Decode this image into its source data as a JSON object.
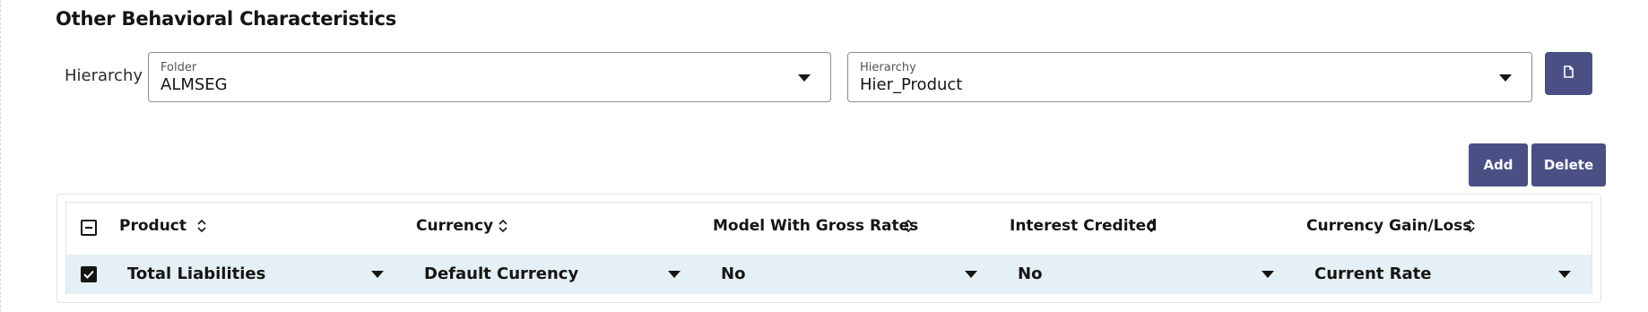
{
  "section": {
    "title": "Other Behavioral Characteristics"
  },
  "hierarchy": {
    "label": "Hierarchy",
    "folder": {
      "label": "Folder",
      "value": "ALMSEG"
    },
    "hierarchy_select": {
      "label": "Hierarchy",
      "value": "Hier_Product"
    },
    "view_button_icon": "document-icon"
  },
  "actions": {
    "add": "Add",
    "delete": "Delete"
  },
  "table": {
    "columns": [
      "Product",
      "Currency",
      "Model With Gross Rates",
      "Interest Credited",
      "Currency Gain/Loss"
    ],
    "rows": [
      {
        "checked": true,
        "cells": [
          "Total Liabilities",
          "Default Currency",
          "No",
          "No",
          "Current Rate"
        ]
      }
    ]
  },
  "colors": {
    "button": "#4b5084",
    "row_highlight": "#e4f0f5"
  }
}
